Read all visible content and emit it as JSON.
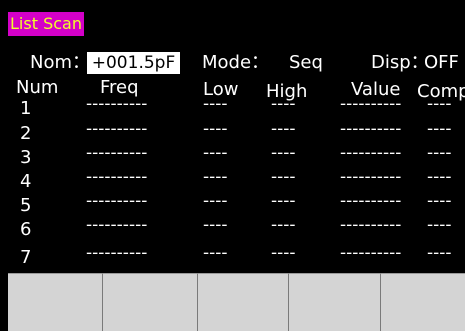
{
  "title": "List Scan",
  "header": {
    "nom_label": "Nom：",
    "nom_value": "+001.5pF",
    "mode_label": "Mode：",
    "mode_value": "Seq",
    "disp_label": "Disp：",
    "disp_value": "OFF"
  },
  "columns": [
    "Num",
    "Freq",
    "Low",
    "High",
    "Value",
    "Comp"
  ],
  "rows": [
    {
      "num": "1",
      "freq": "----------",
      "low": "----",
      "high": "----",
      "value": "----------",
      "comp": "----"
    },
    {
      "num": "2",
      "freq": "----------",
      "low": "----",
      "high": "----",
      "value": "----------",
      "comp": "----"
    },
    {
      "num": "3",
      "freq": "----------",
      "low": "----",
      "high": "----",
      "value": "----------",
      "comp": "----"
    },
    {
      "num": "4",
      "freq": "----------",
      "low": "----",
      "high": "----",
      "value": "----------",
      "comp": "----"
    },
    {
      "num": "5",
      "freq": "----------",
      "low": "----",
      "high": "----",
      "value": "----------",
      "comp": "----"
    },
    {
      "num": "6",
      "freq": "----------",
      "low": "----",
      "high": "----",
      "value": "----------",
      "comp": "----"
    },
    {
      "num": "7",
      "freq": "----------",
      "low": "----",
      "high": "----",
      "value": "----------",
      "comp": "----"
    }
  ],
  "softkeys": [
    "",
    "",
    "",
    "",
    ""
  ],
  "colors": {
    "title_bg": "#d400c8",
    "title_fg": "#f0ff2a",
    "screen_bg": "#000000",
    "softkey_bg": "#d4d4d4"
  }
}
